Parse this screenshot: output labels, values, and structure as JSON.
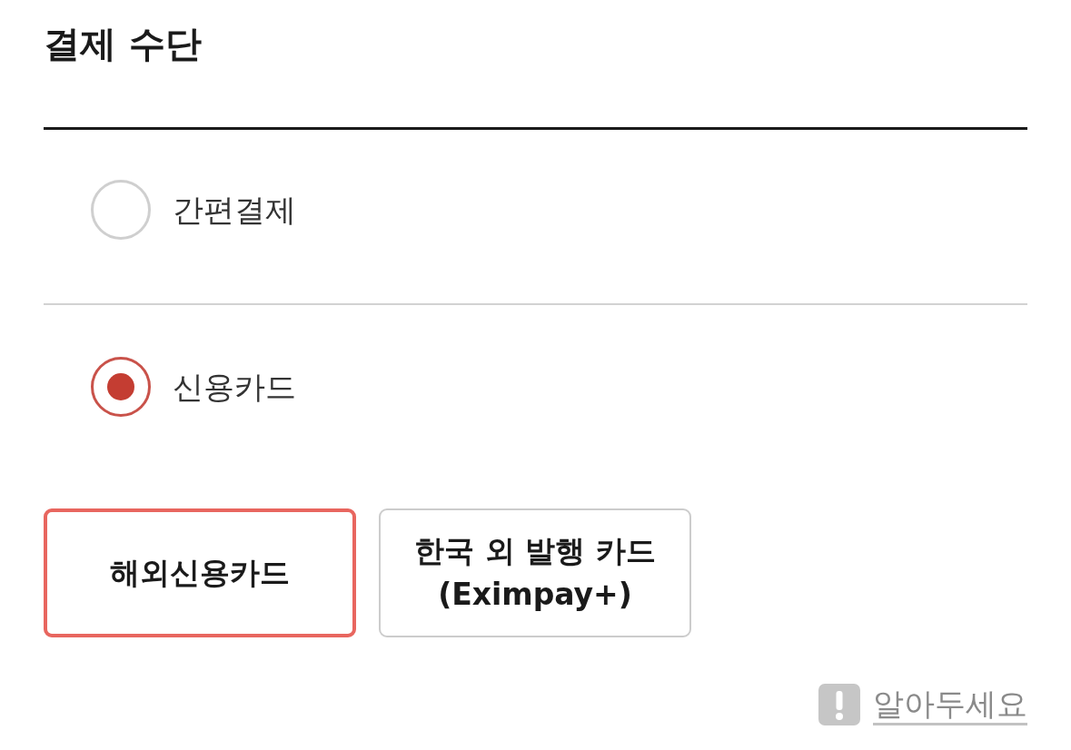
{
  "section": {
    "title": "결제 수단"
  },
  "payment_methods": [
    {
      "label": "간편결제",
      "selected": false
    },
    {
      "label": "신용카드",
      "selected": true
    }
  ],
  "card_types": [
    {
      "label_lines": [
        "해외신용카드"
      ],
      "selected": true
    },
    {
      "label_lines": [
        "한국 외 발행 카드",
        "(Eximpay+)"
      ],
      "selected": false
    }
  ],
  "notice_link": {
    "label": "알아두세요"
  }
}
